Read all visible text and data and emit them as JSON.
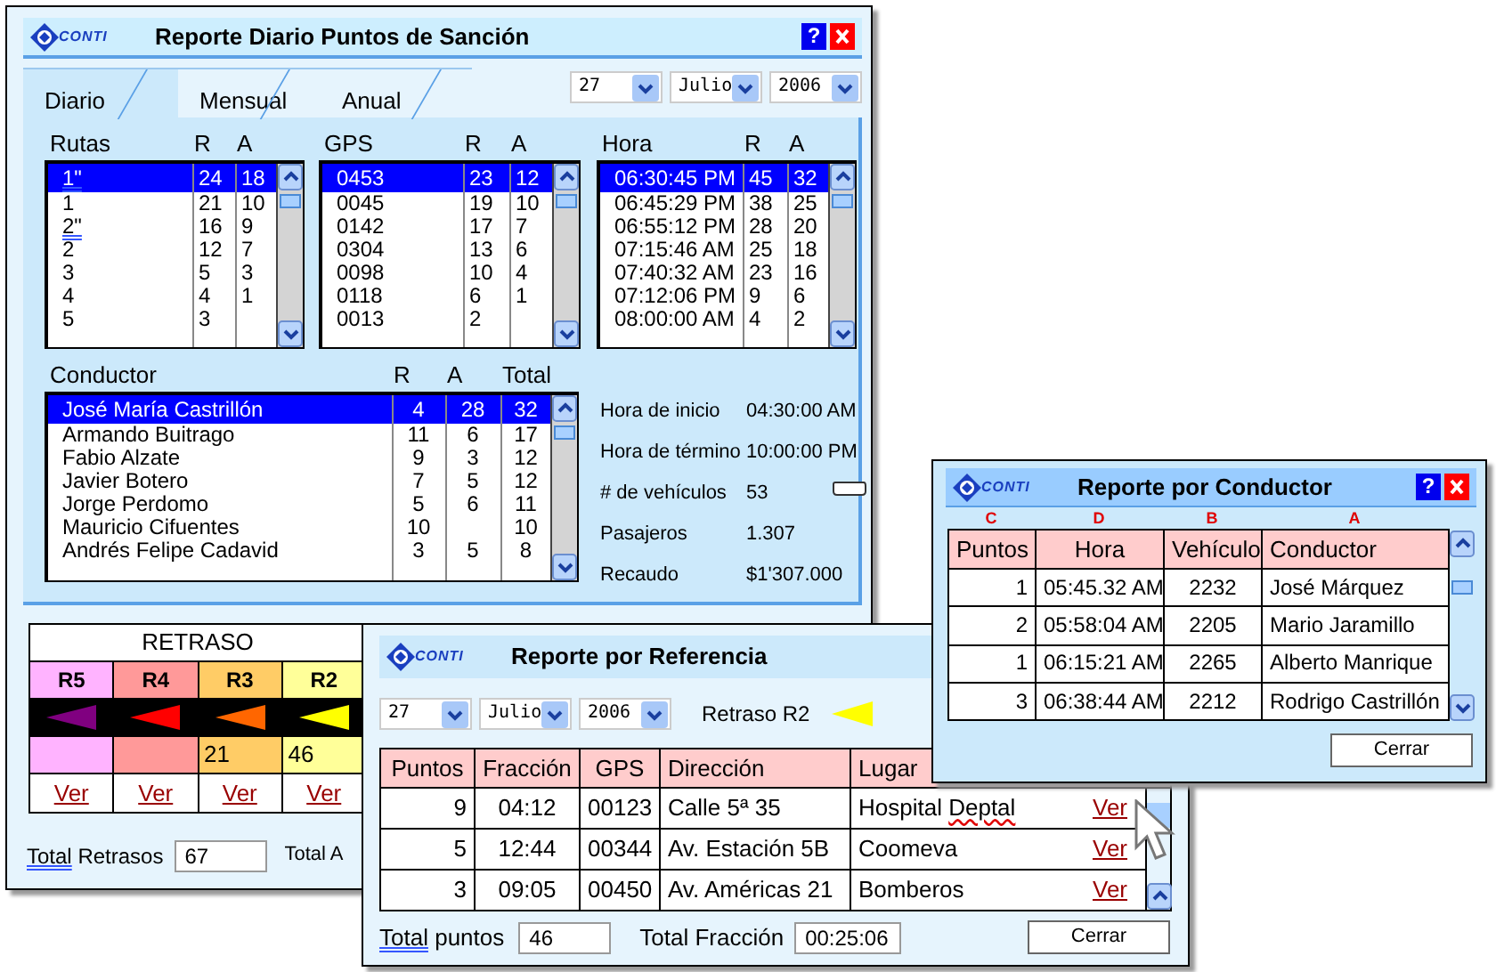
{
  "main_window": {
    "logo": "CONTI",
    "title": "Reporte Diario Puntos de Sanción",
    "help_label": "?",
    "tabs": [
      {
        "label": "Diario",
        "selected": true
      },
      {
        "label": "Mensual",
        "selected": false
      },
      {
        "label": "Anual",
        "selected": false
      }
    ],
    "date": {
      "day": "27",
      "month": "Julio",
      "year": "2006"
    },
    "lists": [
      {
        "columns": [
          "Rutas",
          "R",
          "A"
        ],
        "rows": [
          {
            "cells": [
              "1\"",
              "24",
              "18"
            ],
            "selected": true,
            "marked": true
          },
          {
            "cells": [
              "1",
              "21",
              "10"
            ],
            "selected": false,
            "marked": false
          },
          {
            "cells": [
              "2\"",
              "16",
              "9"
            ],
            "selected": false,
            "marked": true
          },
          {
            "cells": [
              "2",
              "12",
              "7"
            ],
            "selected": false,
            "marked": false
          },
          {
            "cells": [
              "3",
              "5",
              "3"
            ],
            "selected": false,
            "marked": false
          },
          {
            "cells": [
              "4",
              "4",
              "1"
            ],
            "selected": false,
            "marked": false
          },
          {
            "cells": [
              "5",
              "3"
            ],
            "selected": false,
            "marked": false
          }
        ]
      },
      {
        "columns": [
          "GPS",
          "R",
          "A"
        ],
        "rows": [
          {
            "cells": [
              "0453",
              "23",
              "12"
            ],
            "selected": true
          },
          {
            "cells": [
              "0045",
              "19",
              "10"
            ],
            "selected": false
          },
          {
            "cells": [
              "0142",
              "17",
              "7"
            ],
            "selected": false
          },
          {
            "cells": [
              "0304",
              "13",
              "6"
            ],
            "selected": false
          },
          {
            "cells": [
              "0098",
              "10",
              "4"
            ],
            "selected": false
          },
          {
            "cells": [
              "0118",
              "6",
              "1"
            ],
            "selected": false
          },
          {
            "cells": [
              "0013",
              "2"
            ],
            "selected": false
          }
        ]
      },
      {
        "columns": [
          "Hora",
          "R",
          "A"
        ],
        "rows": [
          {
            "cells": [
              "06:30:45 PM",
              "45",
              "32"
            ],
            "selected": true
          },
          {
            "cells": [
              "06:45:29 PM",
              "38",
              "25"
            ],
            "selected": false
          },
          {
            "cells": [
              "06:55:12 PM",
              "28",
              "20"
            ],
            "selected": false
          },
          {
            "cells": [
              "07:15:46 AM",
              "25",
              "18"
            ],
            "selected": false
          },
          {
            "cells": [
              "07:40:32 AM",
              "23",
              "16"
            ],
            "selected": false
          },
          {
            "cells": [
              "07:12:06 PM",
              "9",
              "6"
            ],
            "selected": false
          },
          {
            "cells": [
              "08:00:00 AM",
              "4",
              "2"
            ],
            "selected": false
          }
        ]
      }
    ],
    "drivers": {
      "columns": [
        "Conductor",
        "R",
        "A",
        "Total"
      ],
      "rows": [
        {
          "cells": [
            "José María Castrillón",
            "4",
            "28",
            "32"
          ],
          "selected": true
        },
        {
          "cells": [
            "Armando Buitrago",
            "11",
            "6",
            "17"
          ],
          "selected": false
        },
        {
          "cells": [
            "Fabio Alzate",
            "9",
            "3",
            "12"
          ],
          "selected": false
        },
        {
          "cells": [
            "Javier Botero",
            "7",
            "5",
            "12"
          ],
          "selected": false
        },
        {
          "cells": [
            "Jorge Perdomo",
            "5",
            "6",
            "11"
          ],
          "selected": false
        },
        {
          "cells": [
            "Mauricio Cifuentes",
            "10",
            null,
            "10"
          ],
          "selected": false
        },
        {
          "cells": [
            "Andrés Felipe Cadavid",
            "3",
            "5",
            "8"
          ],
          "selected": false
        }
      ]
    },
    "summary": [
      {
        "label": "Hora de inicio",
        "value": "04:30:00 AM"
      },
      {
        "label": "Hora de término",
        "value": "10:00:00 PM"
      },
      {
        "label": "# de vehículos",
        "value": "53"
      },
      {
        "label": "Pasajeros",
        "value": "1.307"
      },
      {
        "label": "Recaudo",
        "value": "$1'307.000"
      }
    ],
    "retraso": {
      "title": "RETRASO",
      "levels": [
        {
          "label": "R5",
          "color": "#ffb3ff",
          "link": "Ver"
        },
        {
          "label": "R4",
          "color": "#ff9999",
          "link": "Ver"
        },
        {
          "label": "R3",
          "color": "#ffcc66",
          "value": "21",
          "link": "Ver"
        },
        {
          "label": "R2",
          "color": "#ffff99",
          "value": "46",
          "link": "Ver"
        }
      ],
      "arrows": [
        {
          "color": "#800080"
        },
        {
          "color": "#ff0000"
        },
        {
          "color": "#ff6600"
        },
        {
          "color": "#ffff00"
        }
      ]
    },
    "total_retrasos": {
      "label_parts": [
        {
          "text": "Total",
          "grammar_mark": true
        },
        {
          "text": "Retrasos",
          "grammar_mark": false
        }
      ],
      "value": "67"
    },
    "total_cut_label": "Total A"
  },
  "referencia_window": {
    "logo": "CONTI",
    "title": "Reporte por Referencia",
    "date": {
      "day": "27",
      "month": "Julio",
      "year": "2006"
    },
    "retraso_label": "Retraso R2",
    "arrow": {
      "color": "#ffff00"
    },
    "columns": [
      "Puntos",
      "Fracción",
      "GPS",
      "Dirección",
      "Lugar"
    ],
    "rows": [
      {
        "cells": [
          "9",
          "04:12",
          "00123",
          "Calle 5ª 35"
        ],
        "place_parts": [
          {
            "text": "Hospital",
            "spelling_mark": false
          },
          {
            "text": "Deptal",
            "spelling_mark": true
          }
        ],
        "link": "Ver"
      },
      {
        "cells": [
          "5",
          "12:44",
          "00344",
          "Av. Estación 5B"
        ],
        "place_parts": [
          {
            "text": "Coomeva",
            "spelling_mark": false
          }
        ],
        "link": "Ver"
      },
      {
        "cells": [
          "3",
          "09:05",
          "00450",
          "Av. Américas 21"
        ],
        "place_parts": [
          {
            "text": "Bomberos",
            "spelling_mark": false
          }
        ],
        "link": "Ver"
      }
    ],
    "total_puntos": {
      "label_parts": [
        {
          "text": "Total",
          "grammar_mark": true
        },
        {
          "text": "puntos",
          "grammar_mark": false
        }
      ],
      "value": "46"
    },
    "total_fraccion": {
      "label": "Total Fracción",
      "value": "00:25:06"
    },
    "button": "Cerrar"
  },
  "conductor_window": {
    "logo": "CONTI",
    "title": "Reporte por Conductor",
    "help_label": "?",
    "column_markers": [
      "C",
      "D",
      "B",
      "A"
    ],
    "columns": [
      "Puntos",
      "Hora",
      "Vehículo",
      "Conductor"
    ],
    "rows": [
      {
        "cells": [
          "1",
          "05:45.32 AM",
          "2232",
          "José Márquez"
        ]
      },
      {
        "cells": [
          "2",
          "05:58:04 AM",
          "2205",
          "Mario Jaramillo"
        ]
      },
      {
        "cells": [
          "1",
          "06:15:21 AM",
          "2265",
          "Alberto Manrique"
        ]
      },
      {
        "cells": [
          "3",
          "06:38:44 AM",
          "2212",
          "Rodrigo Castrillón"
        ]
      }
    ],
    "button": "Cerrar"
  }
}
